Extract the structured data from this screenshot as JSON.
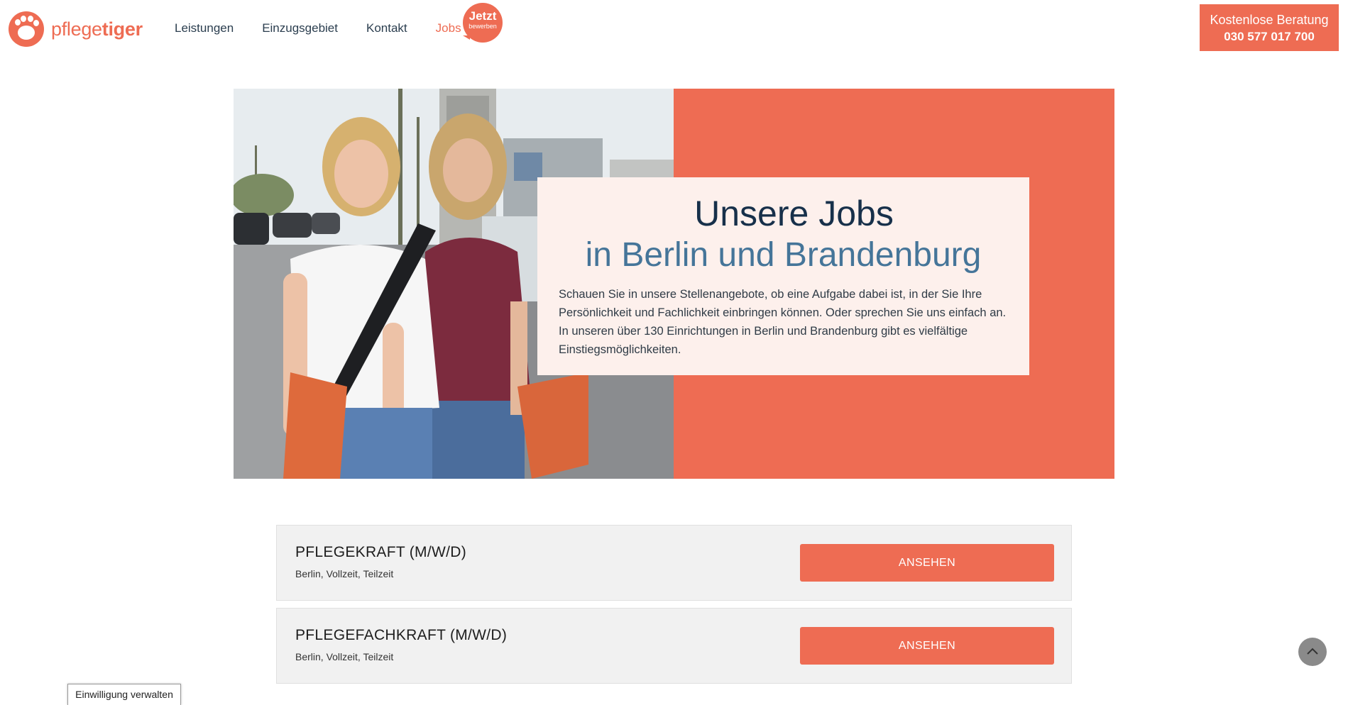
{
  "header": {
    "logo": {
      "text_light": "pflege",
      "text_bold": "tiger"
    },
    "nav": [
      {
        "label": "Leistungen"
      },
      {
        "label": "Einzugsgebiet"
      },
      {
        "label": "Kontakt"
      },
      {
        "label": "Jobs"
      }
    ],
    "badge": {
      "big": "Jetzt",
      "small": "bewerben"
    },
    "cta": {
      "title": "Kostenlose Beratung",
      "phone": "030 577 017 700"
    }
  },
  "hero": {
    "title": "Unsere Jobs",
    "subtitle": "in Berlin und Brandenburg",
    "text": "Schauen Sie in unsere Stellenangebote, ob eine Aufgabe dabei ist, in der Sie Ihre Persönlichkeit und Fachlichkeit einbringen können. Oder sprechen Sie uns einfach an. In unseren über 130 Einrichtungen in Berlin und Brandenburg gibt es vielfältige Einstiegsmöglichkeiten."
  },
  "jobs": [
    {
      "title": "PFLEGEKRAFT (M/W/D)",
      "meta": "Berlin, Vollzeit, Teilzeit",
      "button": "ANSEHEN"
    },
    {
      "title": "PFLEGEFACHKRAFT (M/W/D)",
      "meta": "Berlin, Vollzeit, Teilzeit",
      "button": "ANSEHEN"
    }
  ],
  "consent": {
    "label": "Einwilligung verwalten"
  },
  "colors": {
    "brand": "#ee6c53",
    "navy": "#17304a",
    "blue": "#457599",
    "card": "#fdf0ec"
  },
  "icons": {
    "to_top": "chevron-up-icon",
    "logo": "paw-icon"
  }
}
